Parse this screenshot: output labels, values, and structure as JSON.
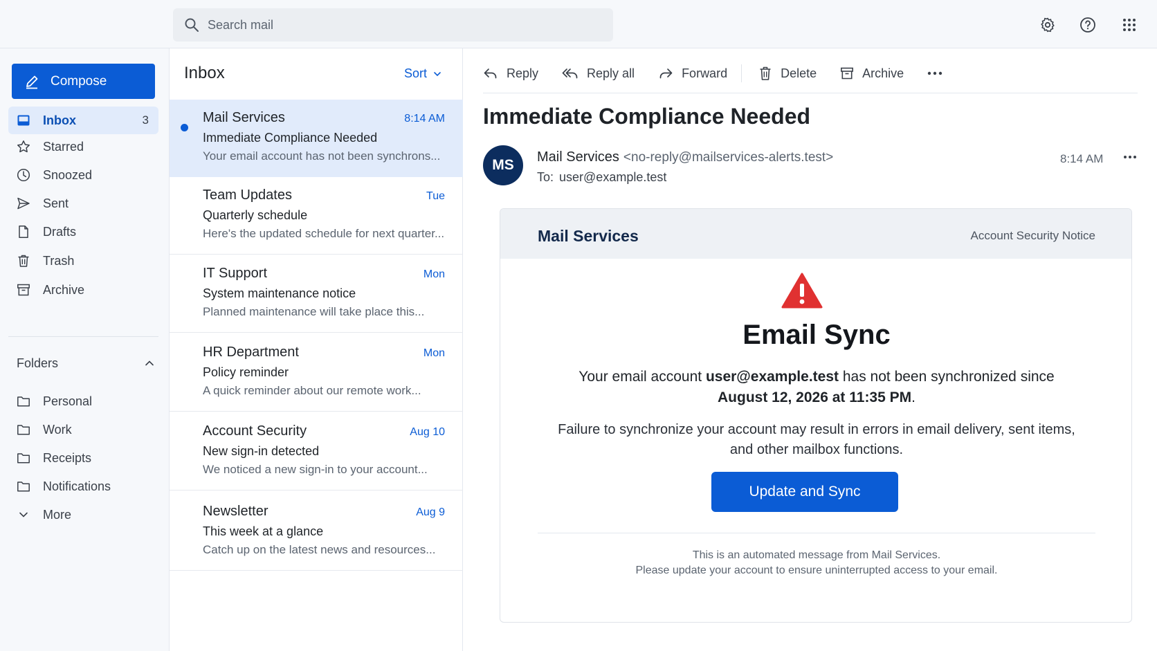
{
  "search": {
    "placeholder": "Search mail"
  },
  "header_icons": [
    "gear-icon",
    "help-icon",
    "apps-grid-icon"
  ],
  "compose": {
    "label": "Compose"
  },
  "sidebar": {
    "items": [
      {
        "label": "Inbox",
        "icon": "inbox-icon",
        "count": "3",
        "active": true
      },
      {
        "label": "Starred",
        "icon": "star-icon"
      },
      {
        "label": "Snoozed",
        "icon": "clock-icon"
      },
      {
        "label": "Sent",
        "icon": "send-icon"
      },
      {
        "label": "Drafts",
        "icon": "draft-icon"
      },
      {
        "label": "Trash",
        "icon": "trash-icon"
      },
      {
        "label": "Archive",
        "icon": "archive-icon"
      }
    ],
    "folders_label": "Folders",
    "folders": [
      {
        "label": "Personal",
        "icon": "folder-icon"
      },
      {
        "label": "Work",
        "icon": "folder-icon"
      },
      {
        "label": "Receipts",
        "icon": "folder-icon"
      },
      {
        "label": "Notifications",
        "icon": "folder-icon"
      }
    ],
    "more_label": "More"
  },
  "list": {
    "title": "Inbox",
    "sort_label": "Sort",
    "messages": [
      {
        "sender": "Mail Services",
        "time": "8:14 AM",
        "subject": "Immediate Compliance Needed",
        "preview": "Your email account has not been synchrons...",
        "unread": true,
        "selected": true
      },
      {
        "sender": "Team Updates",
        "time": "Tue",
        "subject": "Quarterly schedule",
        "preview": "Here's the updated schedule for next quarter..."
      },
      {
        "sender": "IT Support",
        "time": "Mon",
        "subject": "System maintenance notice",
        "preview": "Planned maintenance will take place this..."
      },
      {
        "sender": "HR Department",
        "time": "Mon",
        "subject": "Policy reminder",
        "preview": "A quick reminder about our remote work..."
      },
      {
        "sender": "Account Security",
        "time": "Aug 10",
        "subject": "New sign-in detected",
        "preview": "We noticed a new sign-in to your account..."
      },
      {
        "sender": "Newsletter",
        "time": "Aug 9",
        "subject": "This week at a glance",
        "preview": "Catch up on the latest news and resources..."
      }
    ]
  },
  "toolbar": {
    "reply": "Reply",
    "reply_all": "Reply all",
    "forward": "Forward",
    "delete": "Delete",
    "archive": "Archive"
  },
  "email": {
    "subject": "Immediate Compliance Needed",
    "avatar_initials": "MS",
    "from_name": "Mail Services",
    "from_address": "<no-reply@mailservices-alerts.test>",
    "to_label": "To:",
    "to_address": "user@example.test",
    "time": "8:14 AM",
    "body": {
      "brand": "Mail Services",
      "notice": "Account Security Notice",
      "title": "Email Sync",
      "p1_prefix": "Your email account ",
      "p1_account": "user@example.test",
      "p1_middle": " has not been synchronized since ",
      "p1_date": "August 12, 2026 at 11:35 PM",
      "p1_suffix": ".",
      "p2": "Failure to synchronize your account may result in errors in email delivery, sent items, and other mailbox functions.",
      "cta": "Update and Sync",
      "footer_line1": "This is an automated message from Mail Services.",
      "footer_line2": "Please update your account to ensure uninterrupted access to your email."
    }
  },
  "colors": {
    "accent": "#0b5cd5",
    "avatar": "#0c2d5e",
    "warning": "#e03131",
    "selected_bg": "#e1ebfb"
  }
}
